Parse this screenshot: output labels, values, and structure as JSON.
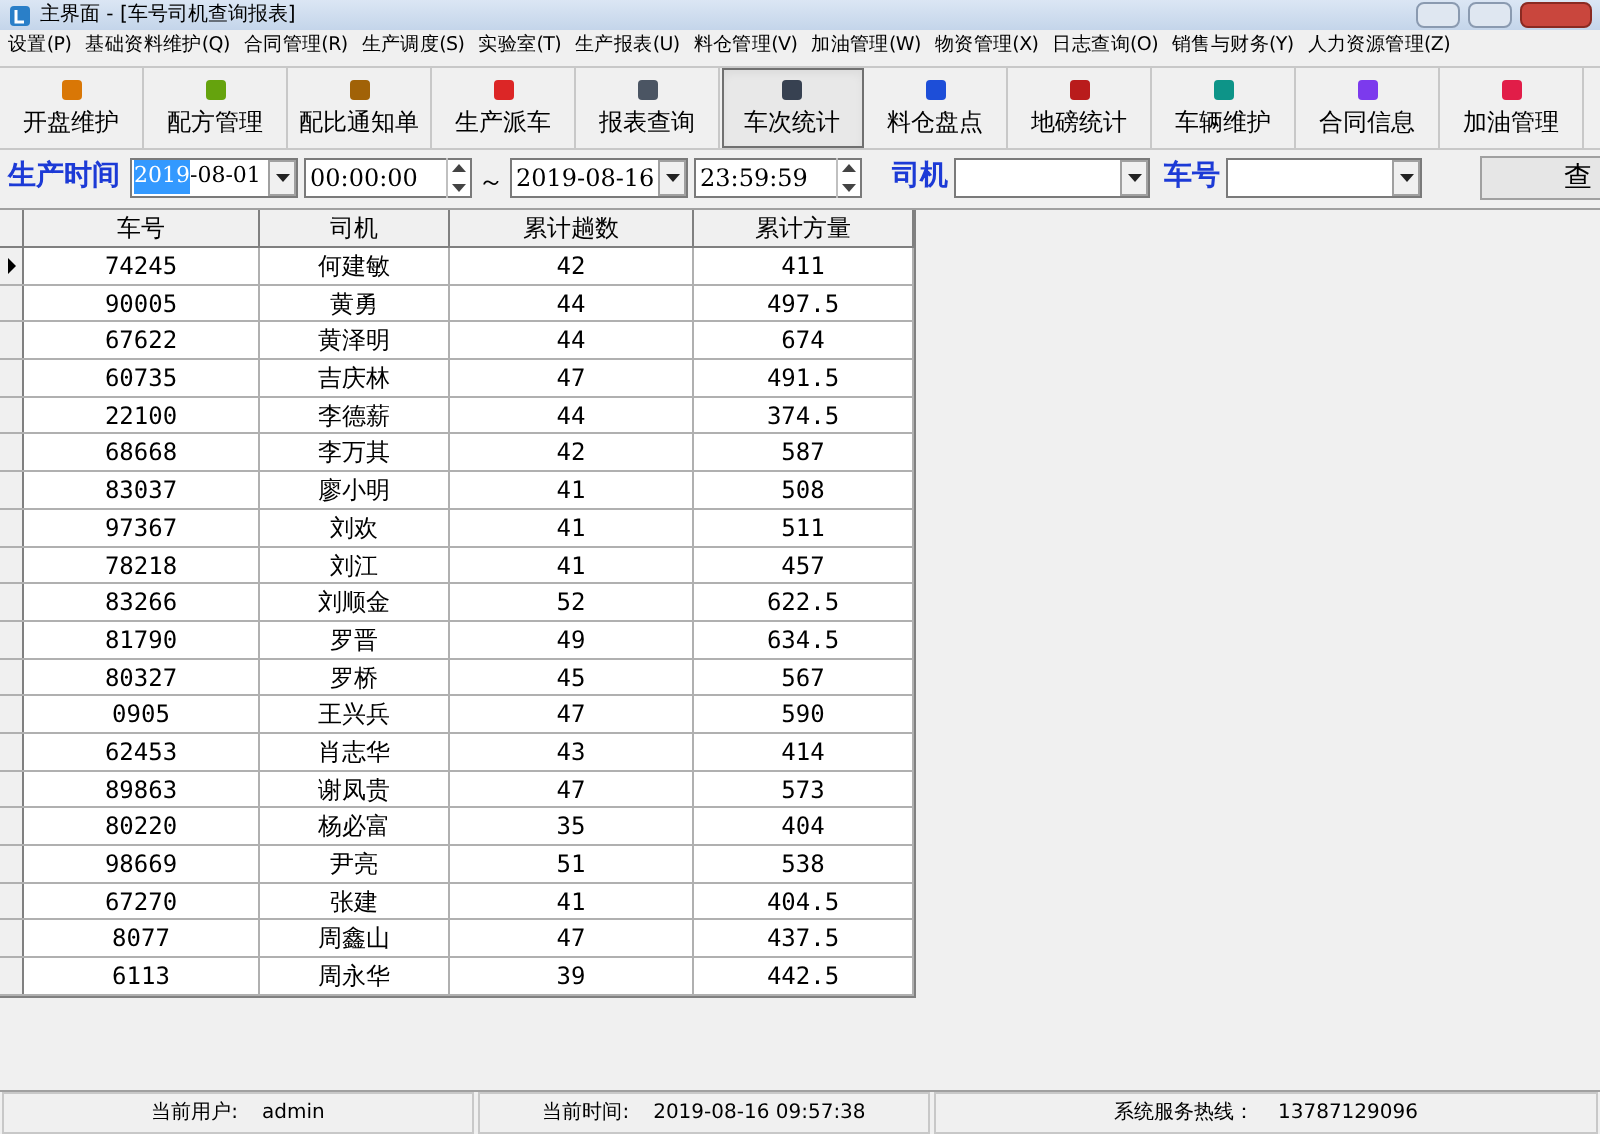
{
  "window": {
    "title": "主界面 - [车号司机查询报表]"
  },
  "menu": [
    "设置(P)",
    "基础资料维护(Q)",
    "合同管理(R)",
    "生产调度(S)",
    "实验室(T)",
    "生产报表(U)",
    "料仓管理(V)",
    "加油管理(W)",
    "物资管理(X)",
    "日志查询(O)",
    "销售与财务(Y)",
    "人力资源管理(Z)"
  ],
  "toolbar": [
    {
      "label": "开盘维护",
      "selected": false
    },
    {
      "label": "配方管理",
      "selected": false
    },
    {
      "label": "配比通知单",
      "selected": false
    },
    {
      "label": "生产派车",
      "selected": false
    },
    {
      "label": "报表查询",
      "selected": false
    },
    {
      "label": "车次统计",
      "selected": true
    },
    {
      "label": "料仓盘点",
      "selected": false
    },
    {
      "label": "地磅统计",
      "selected": false
    },
    {
      "label": "车辆维护",
      "selected": false
    },
    {
      "label": "合同信息",
      "selected": false
    },
    {
      "label": "加油管理",
      "selected": false
    }
  ],
  "filter": {
    "time_label": "生产时间",
    "date_from": {
      "selected_part": "2019",
      "rest": "-08-01"
    },
    "time_from": "00:00:00",
    "range_sep": "～",
    "date_to": "2019-08-16",
    "time_to": "23:59:59",
    "driver_label": "司机",
    "vehicle_label": "车号",
    "query_button": "查"
  },
  "table": {
    "columns": [
      "车号",
      "司机",
      "累计趟数",
      "累计方量"
    ],
    "rows": [
      {
        "cells": [
          "74245",
          "何建敏",
          "42",
          "411"
        ],
        "selected": true
      },
      {
        "cells": [
          "90005",
          "黄勇",
          "44",
          "497.5"
        ],
        "selected": false
      },
      {
        "cells": [
          "67622",
          "黄泽明",
          "44",
          "674"
        ],
        "selected": false
      },
      {
        "cells": [
          "60735",
          "吉庆林",
          "47",
          "491.5"
        ],
        "selected": false
      },
      {
        "cells": [
          "22100",
          "李德薪",
          "44",
          "374.5"
        ],
        "selected": false
      },
      {
        "cells": [
          "68668",
          "李万其",
          "42",
          "587"
        ],
        "selected": false
      },
      {
        "cells": [
          "83037",
          "廖小明",
          "41",
          "508"
        ],
        "selected": false
      },
      {
        "cells": [
          "97367",
          "刘欢",
          "41",
          "511"
        ],
        "selected": false
      },
      {
        "cells": [
          "78218",
          "刘江",
          "41",
          "457"
        ],
        "selected": false
      },
      {
        "cells": [
          "83266",
          "刘顺金",
          "52",
          "622.5"
        ],
        "selected": false
      },
      {
        "cells": [
          "81790",
          "罗晋",
          "49",
          "634.5"
        ],
        "selected": false
      },
      {
        "cells": [
          "80327",
          "罗桥",
          "45",
          "567"
        ],
        "selected": false
      },
      {
        "cells": [
          "0905",
          "王兴兵",
          "47",
          "590"
        ],
        "selected": false
      },
      {
        "cells": [
          "62453",
          "肖志华",
          "43",
          "414"
        ],
        "selected": false
      },
      {
        "cells": [
          "89863",
          "谢凤贵",
          "47",
          "573"
        ],
        "selected": false
      },
      {
        "cells": [
          "80220",
          "杨必富",
          "35",
          "404"
        ],
        "selected": false
      },
      {
        "cells": [
          "98669",
          "尹亮",
          "51",
          "538"
        ],
        "selected": false
      },
      {
        "cells": [
          "67270",
          "张建",
          "41",
          "404.5"
        ],
        "selected": false
      },
      {
        "cells": [
          "8077",
          "周鑫山",
          "47",
          "437.5"
        ],
        "selected": false
      },
      {
        "cells": [
          "6113",
          "周永华",
          "39",
          "442.5"
        ],
        "selected": false
      }
    ]
  },
  "status_bar": [
    {
      "label": "当前用户:",
      "value": "admin"
    },
    {
      "label": "当前时间:",
      "value": "2019-08-16 09:57:38"
    },
    {
      "label": "系统服务热线：",
      "value": "13787129096"
    }
  ]
}
